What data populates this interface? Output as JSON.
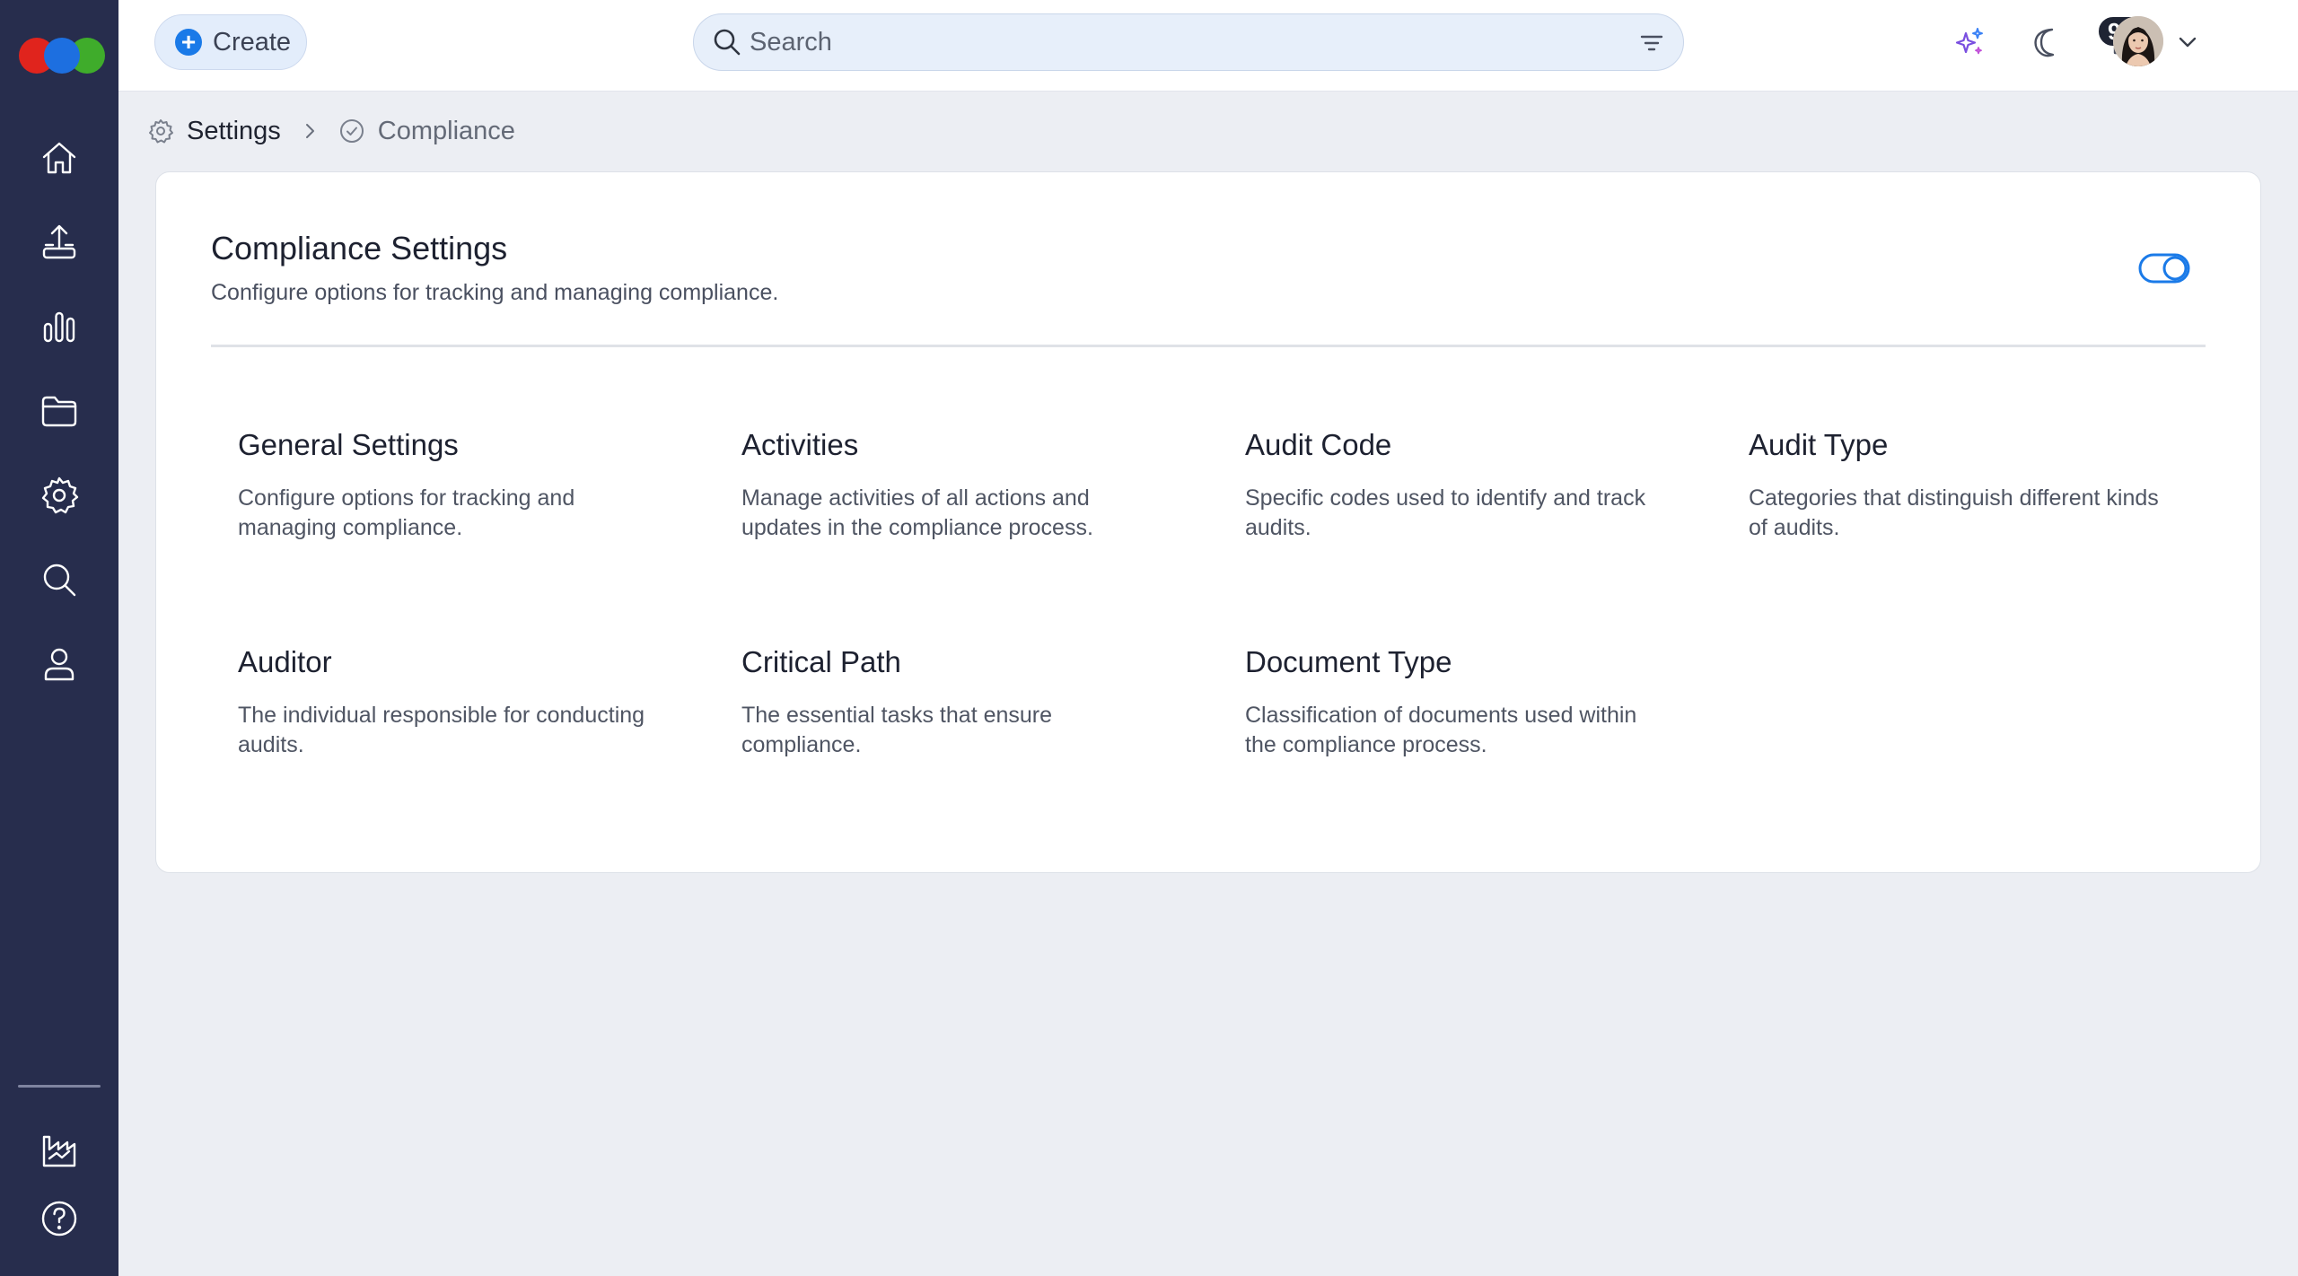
{
  "header": {
    "create_label": "Create",
    "search_placeholder": "Search",
    "notification_count": "99+"
  },
  "breadcrumb": {
    "items": [
      "Settings",
      "Compliance"
    ]
  },
  "card": {
    "title": "Compliance Settings",
    "description": "Configure options for tracking and managing compliance.",
    "tiles": [
      {
        "title": "General Settings",
        "description": "Configure options for tracking and managing compliance."
      },
      {
        "title": "Activities",
        "description": "Manage activities of all actions and updates in the compliance process."
      },
      {
        "title": "Audit Code",
        "description": "Specific codes used to identify and track audits."
      },
      {
        "title": "Audit Type",
        "description": "Categories that distinguish different kinds of audits."
      },
      {
        "title": "Auditor",
        "description": "The individual responsible for conducting audits."
      },
      {
        "title": "Critical Path",
        "description": "The essential tasks that ensure compliance."
      },
      {
        "title": "Document Type",
        "description": "Classification of documents used within the compliance process."
      }
    ]
  },
  "sidebar": {
    "icons": [
      "home-icon",
      "upload-icon",
      "bar-chart-icon",
      "folder-icon",
      "gear-icon",
      "search-icon",
      "user-icon",
      "factory-icon",
      "help-icon"
    ]
  },
  "colors": {
    "sidebar_bg": "#272d4d",
    "accent": "#1a7ae8",
    "page_bg": "#eceef3"
  }
}
